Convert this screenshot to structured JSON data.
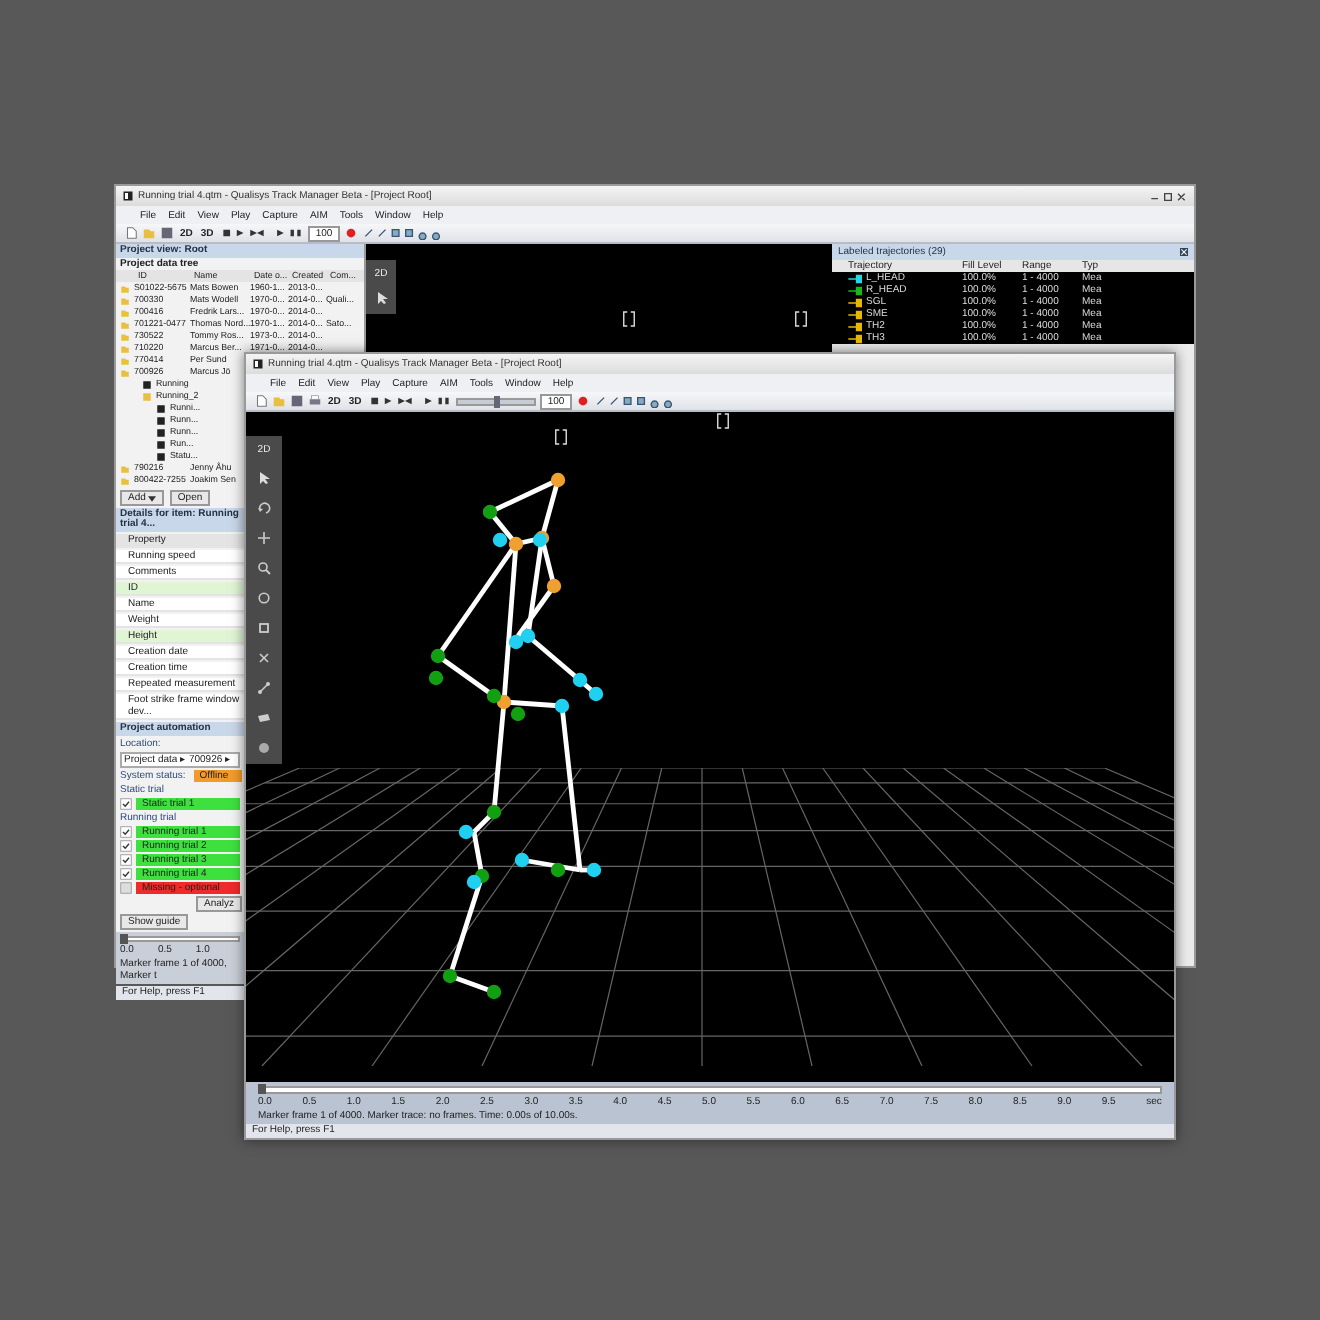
{
  "back_window": {
    "title": "Running trial 4.qtm - Qualisys Track Manager Beta - [Project Root]",
    "menu": [
      "File",
      "Edit",
      "View",
      "Play",
      "Capture",
      "AIM",
      "Tools",
      "Window",
      "Help"
    ],
    "toolbar": {
      "texts": [
        "2D",
        "3D"
      ],
      "speed": "100"
    },
    "view": {
      "palette_label": "2D"
    },
    "project": {
      "title": "Project view: Root",
      "tree_title": "Project data tree",
      "columns": [
        "ID",
        "Name",
        "Date o...",
        "Created",
        "Com..."
      ],
      "rows": [
        {
          "cells": [
            "S01022-5675",
            "Mats Bowen",
            "1960-1...",
            "2013-0..."
          ]
        },
        {
          "cells": [
            "700330",
            "Mats Wodell",
            "1970-0...",
            "2014-0...",
            "Quali..."
          ]
        },
        {
          "cells": [
            "700416",
            "Fredrik Lars...",
            "1970-0...",
            "2014-0..."
          ]
        },
        {
          "cells": [
            "701221-0477",
            "Thomas Nord...",
            "1970-1...",
            "2014-0...",
            "Sato..."
          ]
        },
        {
          "cells": [
            "730522",
            "Tommy Ros...",
            "1973-0...",
            "2014-0..."
          ]
        },
        {
          "cells": [
            "710220",
            "Marcus Ber...",
            "1971-0...",
            "2014-0..."
          ]
        },
        {
          "cells": [
            "770414",
            "Per Sund"
          ]
        },
        {
          "cells": [
            "700926",
            "Marcus Jö"
          ],
          "children": [
            {
              "label": "Running"
            },
            {
              "label": "Running_2",
              "children": [
                {
                  "label": "Runni..."
                },
                {
                  "label": "Runn..."
                },
                {
                  "label": "Runn..."
                },
                {
                  "label": "Run..."
                },
                {
                  "label": "Statu..."
                }
              ]
            }
          ]
        },
        {
          "cells": [
            "790216",
            "Jenny Åhu"
          ]
        },
        {
          "cells": [
            "800422-7255",
            "Joakim Sen"
          ]
        }
      ],
      "buttons": [
        "Add",
        "Open"
      ],
      "details_title": "Details for item: Running trial 4...",
      "property_header": "Property",
      "properties": [
        {
          "label": "Running speed",
          "highlighted": false
        },
        {
          "label": "Comments",
          "highlighted": false
        },
        {
          "label": "ID",
          "highlighted": true
        },
        {
          "label": "Name",
          "highlighted": false
        },
        {
          "label": "Weight",
          "highlighted": false
        },
        {
          "label": "Height",
          "highlighted": true
        },
        {
          "label": "Creation date",
          "highlighted": false
        },
        {
          "label": "Creation time",
          "highlighted": false
        },
        {
          "label": "Repeated measurement",
          "highlighted": false
        },
        {
          "label": "Foot strike frame window dev...",
          "highlighted": false
        }
      ]
    },
    "automation": {
      "title": "Project automation",
      "location_label": "Location:",
      "location": "Project data ▸ 700926 ▸",
      "status_label": "System status:",
      "status_value": "Offline",
      "static_label": "Static trial",
      "static_trials": [
        {
          "label": "Static trial 1",
          "checked": true,
          "color": "#3ee03e"
        }
      ],
      "running_label": "Running trial",
      "running_trials": [
        {
          "label": "Running trial 1",
          "checked": true,
          "color": "#3ee03e"
        },
        {
          "label": "Running trial 2",
          "checked": true,
          "color": "#3ee03e"
        },
        {
          "label": "Running trial 3",
          "checked": true,
          "color": "#3ee03e"
        },
        {
          "label": "Running trial 4",
          "checked": true,
          "color": "#3ee03e"
        },
        {
          "label": "Missing - optional",
          "checked": false,
          "color": "#ee2a2a"
        }
      ],
      "analyze": "Analyz",
      "guide": "Show guide"
    },
    "timeline": {
      "labels": [
        "0.0",
        "0.5",
        "1.0"
      ],
      "level": 0,
      "info": "Marker frame 1 of 4000, Marker t"
    },
    "status_bar": "For Help, press F1",
    "trajectories": {
      "title": "Labeled trajectories (29)",
      "columns": [
        "Trajectory",
        "Fill Level",
        "Range",
        "Typ"
      ],
      "rows": [
        {
          "name": "L_HEAD",
          "color": "#20d8e8",
          "fill": "100.0%",
          "range": "1 - 4000",
          "type": "Mea"
        },
        {
          "name": "R_HEAD",
          "color": "#18b818",
          "fill": "100.0%",
          "range": "1 - 4000",
          "type": "Mea"
        },
        {
          "name": "SGL",
          "color": "#e8b800",
          "fill": "100.0%",
          "range": "1 - 4000",
          "type": "Mea"
        },
        {
          "name": "SME",
          "color": "#e8b800",
          "fill": "100.0%",
          "range": "1 - 4000",
          "type": "Mea"
        },
        {
          "name": "TH2",
          "color": "#e8b800",
          "fill": "100.0%",
          "range": "1 - 4000",
          "type": "Mea"
        },
        {
          "name": "TH3",
          "color": "#e8b800",
          "fill": "100.0%",
          "range": "1 - 4000",
          "type": "Mea"
        }
      ]
    }
  },
  "front_window": {
    "title": "Running trial 4.qtm - Qualisys Track Manager Beta - [Project Root]",
    "menu": [
      "File",
      "Edit",
      "View",
      "Play",
      "Capture",
      "AIM",
      "Tools",
      "Window",
      "Help"
    ],
    "toolbar": {
      "texts": [
        "2D",
        "3D"
      ],
      "speed": "100",
      "level": 0.5
    },
    "view": {
      "palette_label": "2D"
    },
    "timeline": {
      "labels": [
        "0.0",
        "0.5",
        "1.0",
        "1.5",
        "2.0",
        "2.5",
        "3.0",
        "3.5",
        "4.0",
        "4.5",
        "5.0",
        "5.5",
        "6.0",
        "6.5",
        "7.0",
        "7.5",
        "8.0",
        "8.5",
        "9.0",
        "9.5"
      ],
      "unit": "sec",
      "level": 0,
      "info": "Marker frame 1 of 4000. Marker trace: no frames. Time: 0.00s of 10.00s."
    },
    "status_bar": "For Help, press F1"
  }
}
